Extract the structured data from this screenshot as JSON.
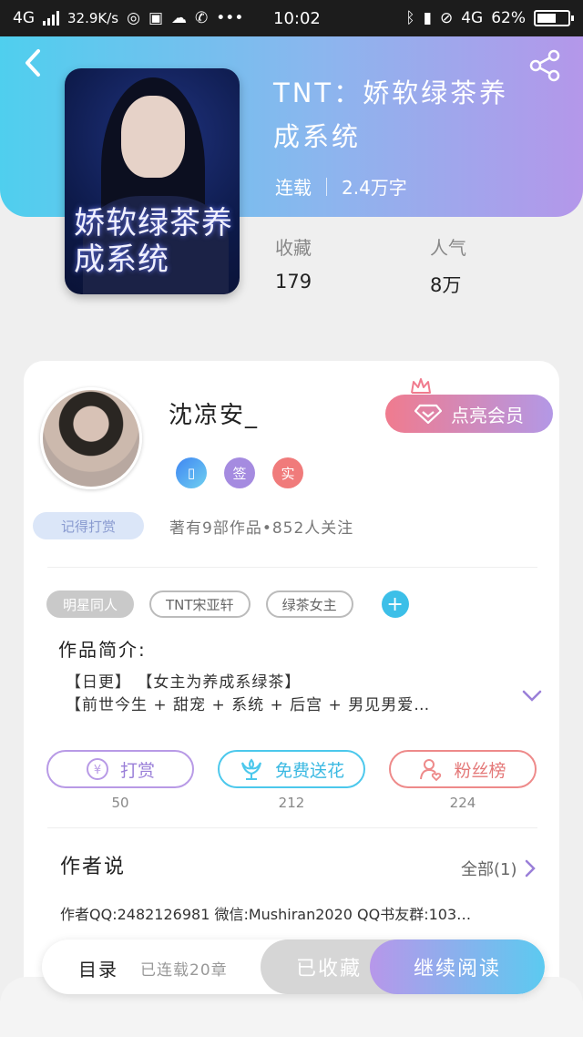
{
  "status_bar": {
    "network": "4G",
    "speed": "32.9K/s",
    "time": "10:02",
    "network_right": "4G",
    "battery": "62%",
    "battery_level": 0.62
  },
  "book": {
    "title": "TNT：娇软绿茶养成系统",
    "cover_title": "娇软绿茶养成系统",
    "status": "连载",
    "word_count": "2.4万字",
    "stats": [
      {
        "label": "收藏",
        "value": "179"
      },
      {
        "label": "人气",
        "value": "8万"
      }
    ]
  },
  "author": {
    "name": "沈凉安_",
    "vip_button": "点亮会员",
    "badges": [
      "签",
      "实"
    ],
    "tip_badge": "记得打赏",
    "works_info": "著有9部作品•852人关注"
  },
  "tags": [
    "明星同人",
    "TNT宋亚轩",
    "绿茶女主"
  ],
  "tag_add": "+",
  "intro": {
    "title": "作品简介:",
    "line1": "【日更】 【女主为养成系绿茶】",
    "line2": "【前世今生 + 甜宠 + 系统 + 后宫 + 男见男爱…"
  },
  "actions": [
    {
      "label": "打赏",
      "count": "50",
      "icon": "yen-coin-icon"
    },
    {
      "label": "免费送花",
      "count": "212",
      "icon": "flower-icon"
    },
    {
      "label": "粉丝榜",
      "count": "224",
      "icon": "fans-user-icon"
    }
  ],
  "author_say": {
    "title": "作者说",
    "all_label": "全部(1)",
    "text": "作者QQ:2482126981 微信:Mushiran2020 QQ书友群:103…"
  },
  "bottom_bar": {
    "toc": "目录",
    "chapters": "已连载20章",
    "collected": "已收藏",
    "continue": "继续阅读"
  },
  "colors": {
    "header_gradient_start": "#4fcfee",
    "header_gradient_end": "#b497ea",
    "accent_blue": "#3cbfe8",
    "accent_purple": "#b89ae6",
    "accent_red": "#ee8a8a"
  }
}
